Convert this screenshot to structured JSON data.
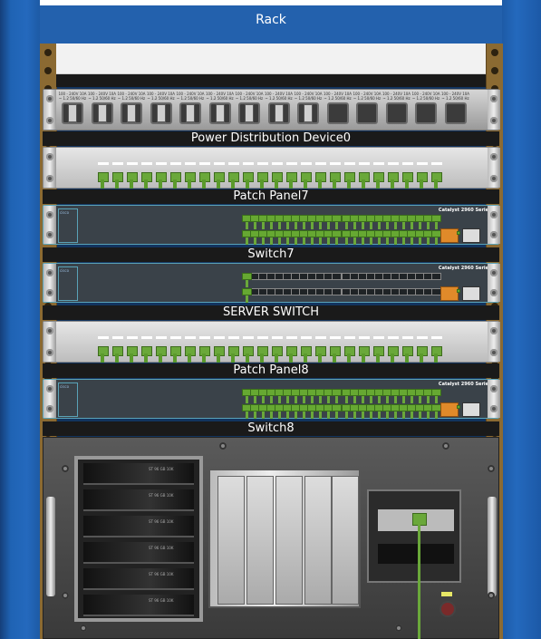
{
  "rack": {
    "title": "Rack"
  },
  "devices": {
    "pdu": {
      "label": "Power Distribution Device0",
      "outlet_spec": "100 - 240V 10A ~ 1.2 50/60 Hz",
      "outlets_total": 14,
      "outlets_plugged": 9
    },
    "patch7": {
      "label": "Patch Panel7"
    },
    "switch7": {
      "label": "Switch7",
      "brand": "Catalyst 2960 Series",
      "logo": "cisco"
    },
    "server_switch": {
      "label": "SERVER SWITCH",
      "brand": "Catalyst 2960 Series",
      "logo": "cisco"
    },
    "patch8": {
      "label": "Patch Panel8"
    },
    "switch8": {
      "label": "Switch8",
      "brand": "Catalyst 2960 Series",
      "logo": "cisco"
    },
    "server": {
      "drive_label": "ST 96 GB 10K"
    }
  },
  "colors": {
    "rack_blue": "#1f63b4",
    "cable_green": "#6aa83a",
    "switch_border": "#5aa3b8"
  },
  "icons": [
    "power-outlet-icon",
    "ethernet-port-icon",
    "uplink-port-icon",
    "power-button-icon"
  ]
}
